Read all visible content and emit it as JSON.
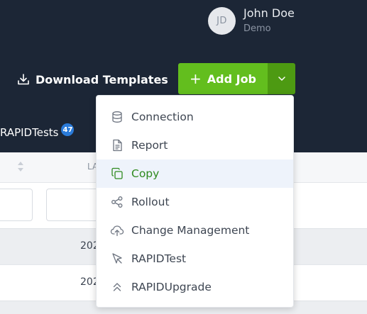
{
  "user": {
    "initials": "JD",
    "name": "John Doe",
    "role": "Demo"
  },
  "toolbar": {
    "download_label": "Download Templates",
    "add_job_label": "Add Job"
  },
  "tab": {
    "label": "RAPIDTests",
    "count": "47"
  },
  "table": {
    "column_header": "LA",
    "rows": [
      "202",
      "202"
    ]
  },
  "menu": {
    "items": [
      {
        "label": "Connection",
        "icon": "database-icon"
      },
      {
        "label": "Report",
        "icon": "document-icon"
      },
      {
        "label": "Copy",
        "icon": "copy-icon"
      },
      {
        "label": "Rollout",
        "icon": "share-icon"
      },
      {
        "label": "Change Management",
        "icon": "cloud-upload-icon"
      },
      {
        "label": "RAPIDTest",
        "icon": "cursor-icon"
      },
      {
        "label": "RAPIDUpgrade",
        "icon": "double-chevron-up-icon"
      }
    ],
    "active_index": 2
  },
  "colors": {
    "header_bg": "#1c2636",
    "accent_green": "#63be1e",
    "accent_green_dark": "#4d9a12",
    "badge_blue": "#2b7bd9",
    "active_text": "#2e8a1e"
  }
}
